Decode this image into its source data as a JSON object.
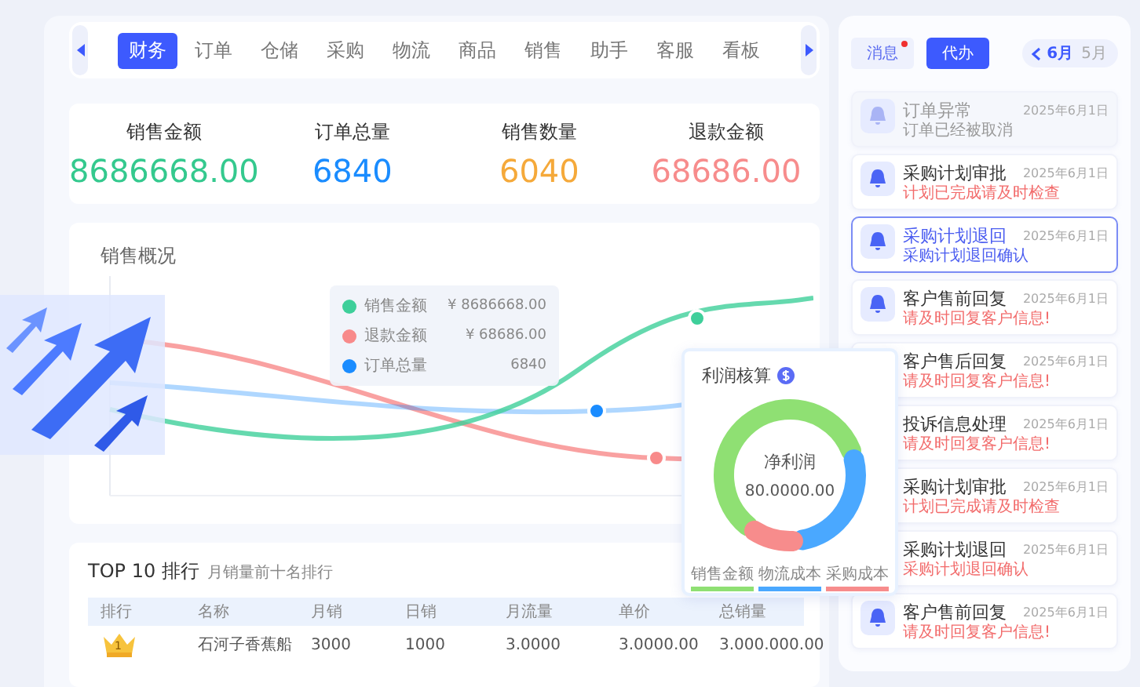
{
  "tabs": [
    {
      "label": "财务",
      "selected": true
    },
    {
      "label": "订单",
      "selected": false
    },
    {
      "label": "仓储",
      "selected": false
    },
    {
      "label": "采购",
      "selected": false
    },
    {
      "label": "物流",
      "selected": false
    },
    {
      "label": "商品",
      "selected": false
    },
    {
      "label": "销售",
      "selected": false
    },
    {
      "label": "助手",
      "selected": false
    },
    {
      "label": "客服",
      "selected": false
    },
    {
      "label": "看板",
      "selected": false
    }
  ],
  "stats": [
    {
      "label": "销售金额",
      "value": "8686668.00",
      "color": "#34c98e"
    },
    {
      "label": "订单总量",
      "value": "6840",
      "color": "#1a8cff"
    },
    {
      "label": "销售数量",
      "value": "6040",
      "color": "#f5a93a"
    },
    {
      "label": "退款金额",
      "value": "68686.00",
      "color": "#f78c8c"
    }
  ],
  "sales_chart": {
    "title": "销售概况",
    "tooltip": [
      {
        "label": "销售金额",
        "value": "¥ 8686668.00",
        "color": "#3ecf9a"
      },
      {
        "label": "退款金额",
        "value": "¥ 68686.00",
        "color": "#f88a8a"
      },
      {
        "label": "订单总量",
        "value": "6840",
        "color": "#1a8cff"
      }
    ]
  },
  "ranking": {
    "title": "TOP 10 排行",
    "subtitle": "月销量前十名排行",
    "columns": [
      "排行",
      "名称",
      "月销",
      "日销",
      "月流量",
      "单价",
      "总销量"
    ],
    "rows": [
      {
        "cells": [
          "1",
          "石河子香蕉船",
          "3000",
          "1000",
          "3.0000",
          "3.0000.00",
          "3.000.000.00"
        ]
      }
    ]
  },
  "profit": {
    "title": "利润核算",
    "center_label": "净利润",
    "center_value": "80.0000.00",
    "legend": [
      {
        "label": "销售金额",
        "color": "#8fe073"
      },
      {
        "label": "物流成本",
        "color": "#4aa8ff"
      },
      {
        "label": "采购成本",
        "color": "#f78c8c"
      }
    ]
  },
  "notices": {
    "tabs": [
      {
        "label": "消息",
        "selected": false,
        "unread": true
      },
      {
        "label": "代办",
        "selected": true,
        "unread": false
      }
    ],
    "months": [
      {
        "label": "6月",
        "selected": true
      },
      {
        "label": "5月",
        "selected": false
      }
    ],
    "items": [
      {
        "title": "订单异常",
        "subtitle": "订单已经被取消",
        "date": "2025年6月1日",
        "selected": false,
        "read": true
      },
      {
        "title": "采购计划审批",
        "subtitle": "计划已完成请及时检查",
        "date": "2025年6月1日",
        "selected": false,
        "read": false
      },
      {
        "title": "采购计划退回",
        "subtitle": "采购计划退回确认",
        "date": "2025年6月1日",
        "selected": true,
        "read": false
      },
      {
        "title": "客户售前回复",
        "subtitle": "请及时回复客户信息!",
        "date": "2025年6月1日",
        "selected": false,
        "read": false
      },
      {
        "title": "客户售后回复",
        "subtitle": "请及时回复客户信息!",
        "date": "2025年6月1日",
        "selected": false,
        "read": false
      },
      {
        "title": "投诉信息处理",
        "subtitle": "请及时回复客户信息!",
        "date": "2025年6月1日",
        "selected": false,
        "read": false
      },
      {
        "title": "采购计划审批",
        "subtitle": "计划已完成请及时检查",
        "date": "2025年6月1日",
        "selected": false,
        "read": false
      },
      {
        "title": "采购计划退回",
        "subtitle": "采购计划退回确认",
        "date": "2025年6月1日",
        "selected": false,
        "read": false
      },
      {
        "title": "客户售前回复",
        "subtitle": "请及时回复客户信息!",
        "date": "2025年6月1日",
        "selected": false,
        "read": false
      }
    ]
  }
}
